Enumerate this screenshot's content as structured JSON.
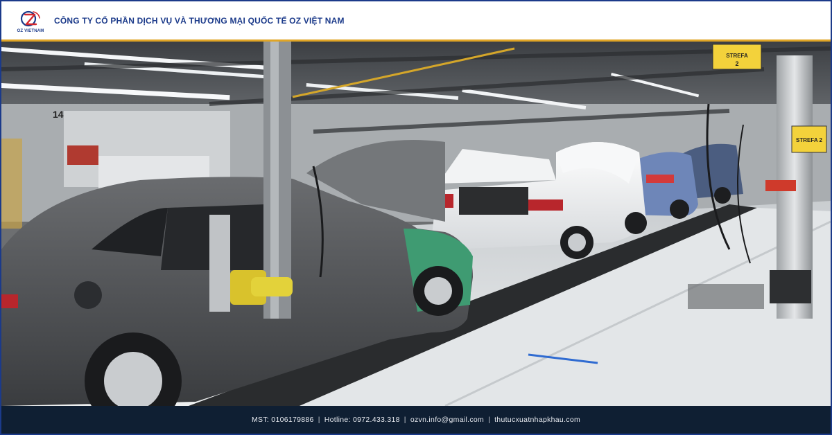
{
  "header": {
    "logo_text": "OZ VIETNAM",
    "company_name": "CÔNG TY CỔ PHẦN DỊCH VỤ VÀ THƯƠNG MẠI QUỐC TẾ OZ VIỆT NAM"
  },
  "photo": {
    "signs": {
      "strefa_top": "STREFA",
      "strefa_top_num": "2",
      "strefa_right": "STREFA 2",
      "station_number": "14"
    }
  },
  "footer": {
    "mst": "MST: 0106179886",
    "hotline": "Hotline: 0972.433.318",
    "email": "ozvn.info@gmail.com",
    "website": "thutucxuatnhapkhau.com",
    "separator": "|"
  },
  "colors": {
    "brand_blue": "#1b3a8a",
    "accent_gold": "#e0a526",
    "logo_red": "#d3262e",
    "footer_bg": "#0f1f33"
  }
}
